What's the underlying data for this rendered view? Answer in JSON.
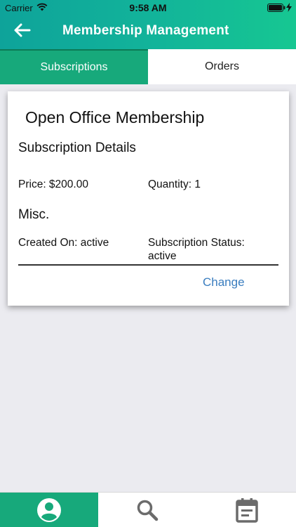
{
  "status_bar": {
    "carrier": "Carrier",
    "time": "9:58 AM"
  },
  "nav": {
    "title": "Membership Management",
    "back_icon": "arrow-left-icon"
  },
  "tabs": [
    {
      "label": "Subscriptions",
      "active": true
    },
    {
      "label": "Orders",
      "active": false
    }
  ],
  "card": {
    "title": "Open Office Membership",
    "subscription_details_heading": "Subscription Details",
    "price": "Price: $200.00",
    "quantity": "Quantity: 1",
    "misc_heading": "Misc.",
    "created_on": "Created On: active",
    "subscription_status": "Subscription Status: active",
    "change_label": "Change"
  },
  "bottom_tabs": [
    {
      "icon": "account-circle-icon",
      "active": true
    },
    {
      "icon": "search-icon",
      "active": false
    },
    {
      "icon": "calendar-icon",
      "active": false
    }
  ],
  "colors": {
    "header_gradient_start": "#0ea39a",
    "header_gradient_end": "#16c792",
    "accent_green": "#17a97b",
    "link_blue": "#3a7dbf",
    "background": "#ebebf0"
  }
}
